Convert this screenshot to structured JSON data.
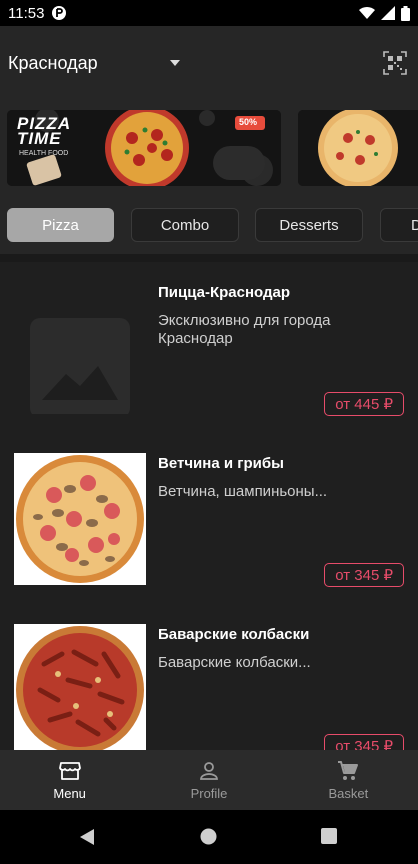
{
  "status": {
    "time": "11:53"
  },
  "header": {
    "city": "Краснодар"
  },
  "icons": {
    "qr": "qr-code-icon",
    "dropdown": "chevron-down-icon",
    "menu": "menu-store-icon",
    "profile": "person-icon",
    "basket": "cart-icon"
  },
  "banner": {
    "brand": "PIZZA TIME",
    "sub": "HEALTH FOOD",
    "discount": "50%"
  },
  "categories": [
    "Pizza",
    "Combo",
    "Desserts",
    "D"
  ],
  "products": [
    {
      "name": "Пицца-Краснодар",
      "description": "Эксклюзивно для города Краснодар",
      "price": "от 445 ₽"
    },
    {
      "name": "Ветчина и грибы",
      "description": "Ветчина, шампиньоны...",
      "price": "от 345 ₽"
    },
    {
      "name": "Баварские колбаски",
      "description": "Баварские колбаски...",
      "price": "от 345 ₽"
    }
  ],
  "bottom_nav": {
    "menu": "Menu",
    "profile": "Profile",
    "basket": "Basket"
  },
  "colors": {
    "accent": "#e74c6a",
    "background": "#1f1f1f",
    "active_tab": "#a7a7a7"
  }
}
